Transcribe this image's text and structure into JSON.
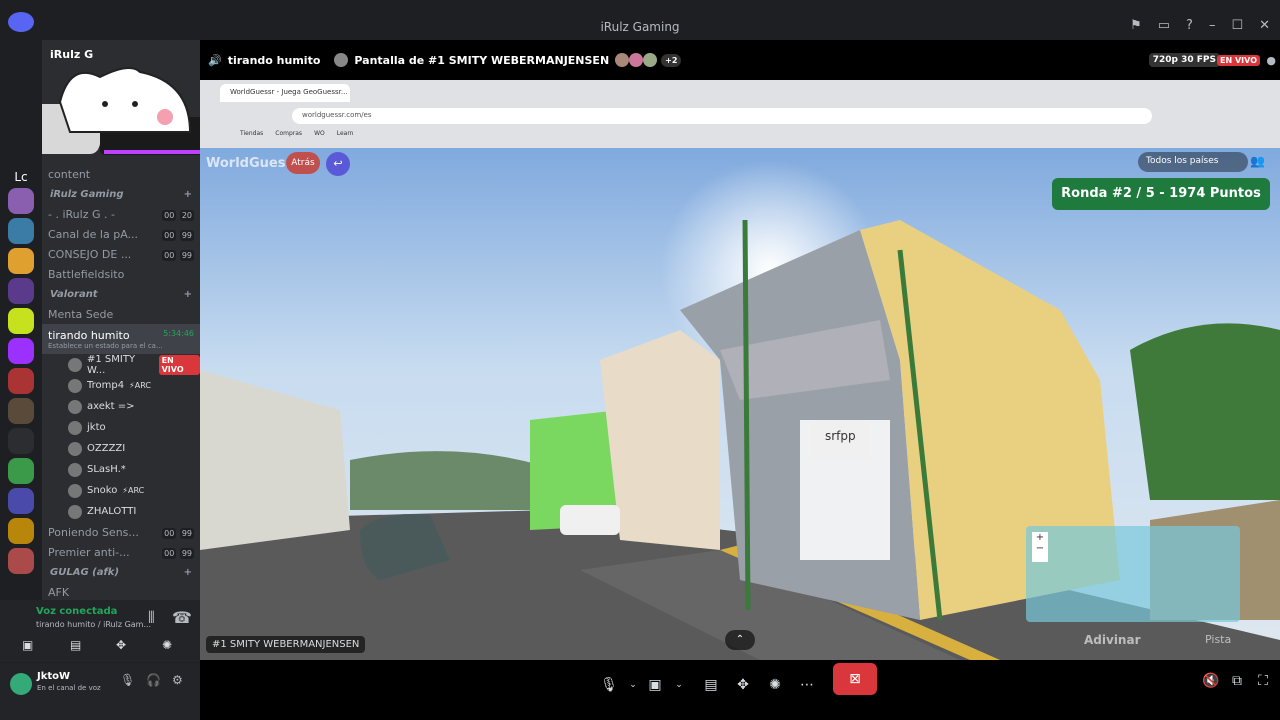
{
  "window": {
    "title": "iRulz Gaming",
    "min": "–",
    "max": "☐",
    "close": "✕"
  },
  "server_list": {
    "initials": "Lc"
  },
  "sidebar": {
    "server_name": "iRulz G",
    "top_channel": "content",
    "categories": [
      {
        "name": "iRulz Gaming",
        "channels": [
          {
            "name": "- . iRulz G . -",
            "c1": "00",
            "c2": "20"
          },
          {
            "name": "Canal de la pA...",
            "c1": "00",
            "c2": "99"
          },
          {
            "name": "CONSEJO DE ...",
            "c1": "00",
            "c2": "99"
          },
          {
            "name": "Battlefieldsito",
            "c1": "",
            "c2": ""
          }
        ]
      },
      {
        "name": "Valorant",
        "channels": [
          {
            "name": "Menta Sede",
            "c1": "",
            "c2": ""
          }
        ]
      }
    ],
    "active_channel": {
      "name": "tirando humito",
      "time": "5:34:46",
      "status": "Establece un estado para el ca..."
    },
    "users": [
      {
        "name": "#1 SMITY W...",
        "badge": "EN VIVO",
        "tag": ""
      },
      {
        "name": "Tromp4",
        "badge": "",
        "tag": "⚡ARC"
      },
      {
        "name": "axekt =>",
        "badge": "",
        "tag": ""
      },
      {
        "name": "jkto",
        "badge": "",
        "tag": ""
      },
      {
        "name": "OZZZZI",
        "badge": "",
        "tag": ""
      },
      {
        "name": "SLasH.*",
        "badge": "",
        "tag": ""
      },
      {
        "name": "Snoko",
        "badge": "",
        "tag": "⚡ARC"
      },
      {
        "name": "ZHALOTTI",
        "badge": "",
        "tag": ""
      }
    ],
    "more_channels": [
      {
        "name": "Poniendo Sens...",
        "c1": "00",
        "c2": "99"
      },
      {
        "name": "Premier anti-...",
        "c1": "00",
        "c2": "99"
      }
    ],
    "gulag_category": "GULAG (afk)",
    "afk": "AFK"
  },
  "voice": {
    "status": "Voz conectada",
    "channel": "tirando humito / iRulz Gam..."
  },
  "user": {
    "name": "JktoW",
    "status": "En el canal de voz"
  },
  "stream_header": {
    "channel": "tirando humito",
    "screen": "Pantalla de #1 SMITY WEBERMANJENSEN",
    "extra": "+2",
    "quality": "720p 30 FPS",
    "live": "EN VIVO"
  },
  "browser": {
    "tab": "WorldGuessr - Juega GeoGuessr...",
    "url": "worldguessr.com/es",
    "bookmarks": [
      "Tiendas",
      "Compras",
      "WO",
      "Learn"
    ]
  },
  "game": {
    "logo": "WorldGuessr",
    "back": "Atrás",
    "countries": "Todos los países",
    "round": "Ronda #2 / 5 - 1974 Puntos",
    "guess": "Adivinar",
    "hint": "Pista",
    "shop_sign": "srfpp"
  },
  "stream_footer": {
    "streamer": "#1 SMITY WEBERMANJENSEN"
  },
  "colors": {
    "bg": "#111214",
    "sidebar": "#2b2d31",
    "accent": "#da373c",
    "round": "#1f7a3e"
  }
}
